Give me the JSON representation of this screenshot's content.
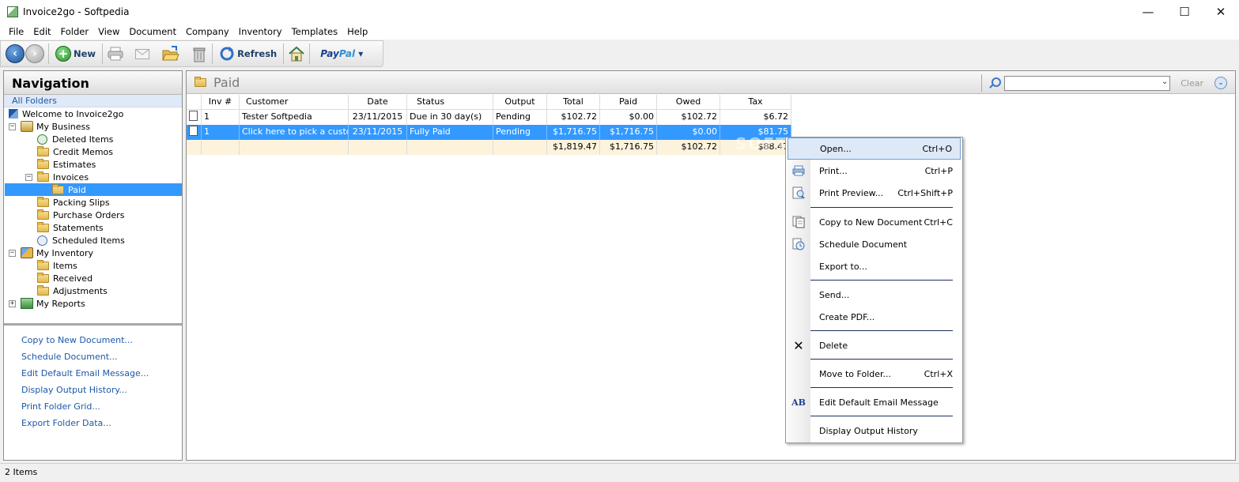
{
  "window": {
    "title": "Invoice2go - Softpedia",
    "minimize": "—",
    "maximize": "☐",
    "close": "✕"
  },
  "menu": [
    "File",
    "Edit",
    "Folder",
    "View",
    "Document",
    "Company",
    "Inventory",
    "Templates",
    "Help"
  ],
  "toolbar": {
    "new_label": "New",
    "refresh_label": "Refresh",
    "paypal_a": "Pay",
    "paypal_b": "Pal",
    "paypal_caret": "▾"
  },
  "nav": {
    "title": "Navigation",
    "all_folders": "All Folders",
    "tree": {
      "welcome": "Welcome to Invoice2go",
      "my_business": "My Business",
      "deleted_items": "Deleted Items",
      "credit_memos": "Credit Memos",
      "estimates": "Estimates",
      "invoices": "Invoices",
      "paid": "Paid",
      "packing_slips": "Packing Slips",
      "purchase_orders": "Purchase Orders",
      "statements": "Statements",
      "scheduled_items": "Scheduled Items",
      "my_inventory": "My Inventory",
      "items": "Items",
      "received": "Received",
      "adjustments": "Adjustments",
      "my_reports": "My Reports"
    },
    "expand_minus": "−",
    "expand_plus": "+",
    "tasks": [
      "Copy to New Document...",
      "Schedule Document...",
      "Edit Default Email Message...",
      "Display Output History...",
      "Print Folder Grid...",
      "Export Folder Data..."
    ]
  },
  "main": {
    "title": "Paid",
    "search": {
      "value": "",
      "dropdown": "⌄",
      "clear": "Clear",
      "chevron": "⌄"
    },
    "columns": [
      "",
      "Inv #",
      "Customer",
      "Date",
      "Status",
      "Output",
      "Total",
      "Paid",
      "Owed",
      "Tax"
    ],
    "rows": [
      {
        "inv": "1",
        "customer": "Tester Softpedia",
        "date": "23/11/2015",
        "status": "Due in 30 day(s)",
        "output": "Pending",
        "total": "$102.72",
        "paid": "$0.00",
        "owed": "$102.72",
        "tax": "$6.72"
      },
      {
        "inv": "1",
        "customer": "Click here to pick a customer",
        "date": "23/11/2015",
        "status": "Fully Paid",
        "output": "Pending",
        "total": "$1,716.75",
        "paid": "$1,716.75",
        "owed": "$0.00",
        "tax": "$81.75"
      }
    ],
    "totals": {
      "total": "$1,819.47",
      "paid": "$1,716.75",
      "owed": "$102.72",
      "tax": "$88.47"
    }
  },
  "context_menu": {
    "open": {
      "label": "Open...",
      "shortcut": "Ctrl+O"
    },
    "print": {
      "label": "Print...",
      "shortcut": "Ctrl+P"
    },
    "print_preview": {
      "label": "Print Preview...",
      "shortcut": "Ctrl+Shift+P"
    },
    "copy": {
      "label": "Copy to New Document",
      "shortcut": "Ctrl+C"
    },
    "schedule": {
      "label": "Schedule Document"
    },
    "export": {
      "label": "Export to..."
    },
    "send": {
      "label": "Send..."
    },
    "pdf": {
      "label": "Create PDF..."
    },
    "delete": {
      "label": "Delete",
      "icon": "✕"
    },
    "move": {
      "label": "Move to Folder...",
      "shortcut": "Ctrl+X"
    },
    "email": {
      "label": "Edit Default Email Message",
      "icon": "AB"
    },
    "history": {
      "label": "Display Output History"
    }
  },
  "status": {
    "items": "2 Items"
  },
  "watermark": "SOFTPEDIA"
}
